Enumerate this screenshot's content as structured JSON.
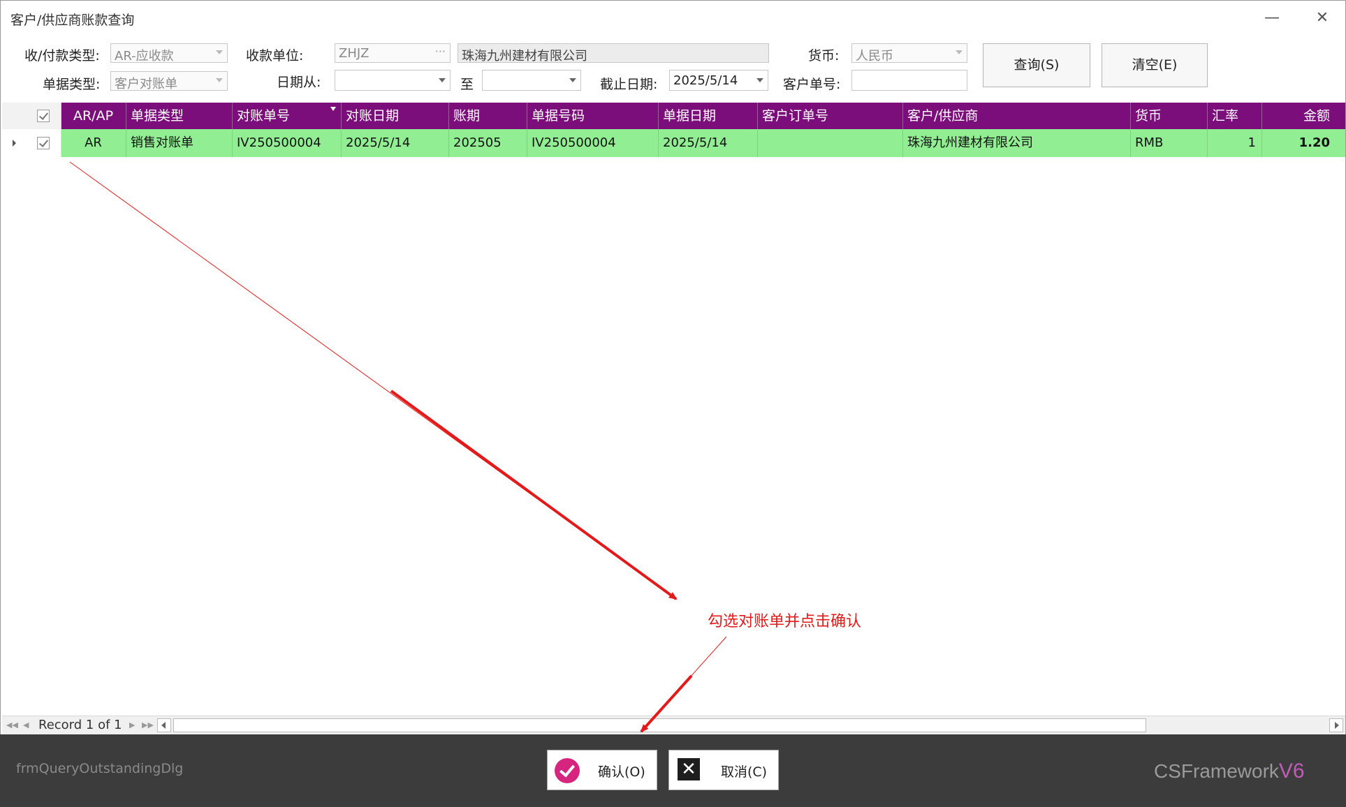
{
  "window": {
    "title": "客户/供应商账款查询",
    "minimize_glyph": "—",
    "close_glyph": "✕"
  },
  "filters": {
    "pay_type_label": "收/付款类型:",
    "pay_type_value": "AR-应收款",
    "unit_label": "收款单位:",
    "unit_code": "ZHJZ",
    "unit_name": "珠海九州建材有限公司",
    "currency_label": "货币:",
    "currency_value": "人民币",
    "doc_type_label": "单据类型:",
    "doc_type_value": "客户对账单",
    "date_from_label": "日期从:",
    "date_from_value": "",
    "to_label": "至",
    "date_to_value": "",
    "cutoff_label": "截止日期:",
    "cutoff_value": "2025/5/14",
    "customer_no_label": "客户单号:",
    "customer_no_value": ""
  },
  "buttons": {
    "query": "查询(S)",
    "clear": "清空(E)"
  },
  "grid": {
    "columns": [
      "AR/AP",
      "单据类型",
      "对账单号",
      "对账日期",
      "账期",
      "单据号码",
      "单据日期",
      "客户订单号",
      "客户/供应商",
      "货币",
      "汇率",
      "金额"
    ],
    "row": {
      "arap": "AR",
      "doc_type": "销售对账单",
      "statement_no": "IV250500004",
      "statement_date": "2025/5/14",
      "period": "202505",
      "doc_no": "IV250500004",
      "doc_date": "2025/5/14",
      "customer_order_no": "",
      "customer": "珠海九州建材有限公司",
      "currency": "RMB",
      "rate": "1",
      "amount": "1.20"
    },
    "record_text": "Record 1 of 1"
  },
  "footer": {
    "form_name": "frmQueryOutstandingDlg",
    "confirm": "确认(O)",
    "cancel": "取消(C)",
    "brand": "CSFramework",
    "brand_version": "V6"
  },
  "annotation": "勾选对账单并点击确认",
  "colors": {
    "header_bg": "#7b0e7b",
    "row_bg": "#92ee92",
    "footer_bg": "#3c3c3c",
    "confirm_icon": "#d6257e",
    "annotation": "#e41a1a"
  }
}
